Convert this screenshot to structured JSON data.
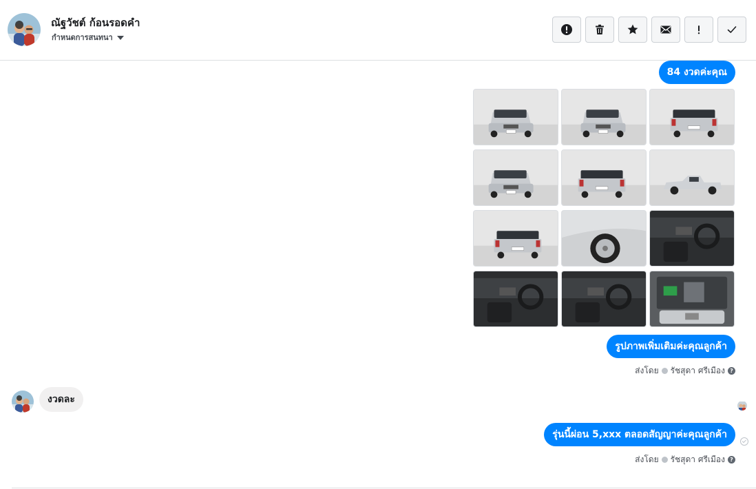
{
  "header": {
    "contact_name": "ณัฐวัชต์ ก้อนรอดคำ",
    "assign_label": "กำหนดการสนทนา",
    "toolbar": [
      {
        "name": "report-spam-button",
        "icon": "alert-circle-icon"
      },
      {
        "name": "delete-button",
        "icon": "trash-icon"
      },
      {
        "name": "star-button",
        "icon": "star-icon"
      },
      {
        "name": "mark-unread-button",
        "icon": "envelope-icon"
      },
      {
        "name": "follow-up-button",
        "icon": "exclamation-icon"
      },
      {
        "name": "mark-done-button",
        "icon": "check-icon"
      }
    ]
  },
  "messages": {
    "out_1": "84 งวดค่ะคุณ",
    "out_2": "รูปภาพเพิ่มเติมค่ะคุณลูกค้า",
    "sent_by_1": {
      "prefix": "ส่งโดย",
      "agent": "รัชสุดา ศรีเมือง",
      "help": "?"
    },
    "in_1": "งวดละ",
    "out_3": "รุ่นนี้ผ่อน 5,xxx ตลอดสัญญาค่ะคุณลูกค้า",
    "sent_by_2": {
      "prefix": "ส่งโดย",
      "agent": "รัชสุดา ศรีเมือง",
      "help": "?"
    }
  },
  "photos": [
    {
      "name": "photo-front-left",
      "view": "front-angle"
    },
    {
      "name": "photo-front",
      "view": "front"
    },
    {
      "name": "photo-rear-right",
      "view": "rear-angle"
    },
    {
      "name": "photo-front-left-2",
      "view": "front-angle"
    },
    {
      "name": "photo-rear",
      "view": "rear"
    },
    {
      "name": "photo-side",
      "view": "side"
    },
    {
      "name": "photo-rear-left",
      "view": "rear-angle"
    },
    {
      "name": "photo-wheel",
      "view": "wheel"
    },
    {
      "name": "photo-gear-shift",
      "view": "interior"
    },
    {
      "name": "photo-dashboard",
      "view": "interior"
    },
    {
      "name": "photo-steering",
      "view": "interior"
    },
    {
      "name": "photo-engine",
      "view": "engine"
    }
  ],
  "colors": {
    "accent": "#0084ff",
    "incoming_bubble": "#f1f0f0",
    "toolbar_bg": "#f5f6f7",
    "border": "#dddfe2"
  }
}
